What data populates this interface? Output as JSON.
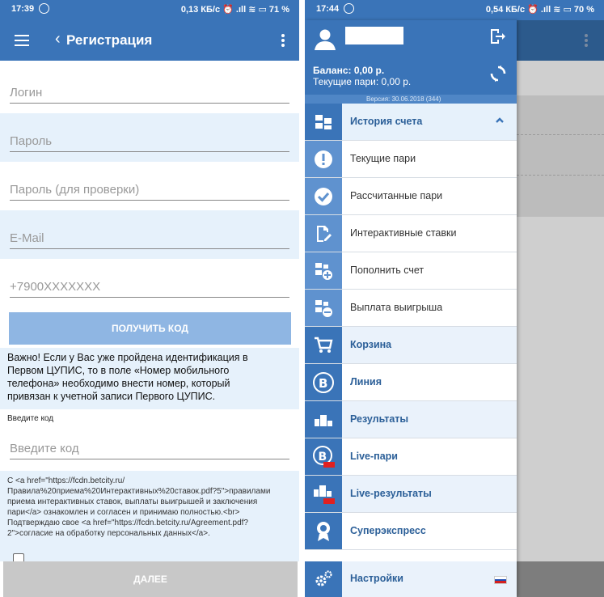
{
  "left": {
    "status": {
      "time": "17:39",
      "stats": "0,13 КБ/с ⏰ .ıll ≋ ▭ 71 %"
    },
    "appbar": {
      "title": "Регистрация"
    },
    "fields": {
      "login": "Логин",
      "password": "Пароль",
      "password_confirm": "Пароль (для проверки)",
      "email": "E-Mail",
      "phone": "+7900XXXXXXX"
    },
    "get_code_label": "ПОЛУЧИТЬ КОД",
    "warning": "Важно! Если у Вас уже пройдена идентификация в Первом ЦУПИС, то в поле «Номер мобильного телефона» необходимо внести номер, который привязан к учетной записи Первого ЦУПИС.",
    "code_label": "Введите код",
    "code_placeholder": "Введите код",
    "terms": "С <a href=\"https://fcdn.betcity.ru/Правила%20приема%20Интерактивных%20ставок.pdf?5\">правилами приема интерактивных ставок, выплаты выигрышей и заключения пари</a>  ознакомлен и согласен и принимаю полностью.<br>  Подтверждаю свое <a href=\"https://fcdn.betcity.ru/Agreement.pdf?2\">согласие на обработку персональных данных</a>.",
    "next_label": "ДАЛЕЕ"
  },
  "right": {
    "status": {
      "time": "17:44",
      "stats": "0,54 КБ/с ⏰ .ıll ≋ ▭ 70 %"
    },
    "balance": "Баланс: 0,00 р.",
    "current_bets": "Текущие пари: 0,00 р.",
    "version": "Версия: 30.06.2018 (344)",
    "menu": {
      "history": "История счета",
      "current": "Текущие пари",
      "settled": "Рассчитанные пари",
      "interactive": "Интерактивные ставки",
      "deposit": "Пополнить счет",
      "payout": "Выплата выигрыша",
      "cart": "Корзина",
      "line": "Линия",
      "results": "Результаты",
      "live_bets": "Live-пари",
      "live_results": "Live-результаты",
      "superexpress": "Суперэкспресс",
      "settings": "Настройки"
    }
  },
  "colors": {
    "primary": "#3a74b8",
    "light_row": "#e6f1fb",
    "button_light": "#8fb6e3",
    "disabled": "#c8c8c8"
  }
}
